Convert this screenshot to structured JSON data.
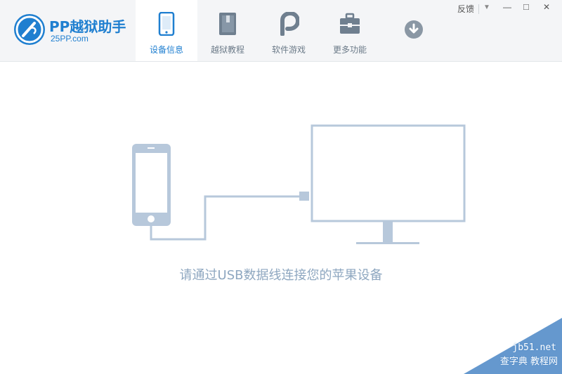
{
  "app": {
    "name": "PP越狱助手",
    "site": "25PP.com"
  },
  "tabs": [
    {
      "label": "设备信息",
      "icon": "phone-icon",
      "active": true
    },
    {
      "label": "越狱教程",
      "icon": "book-icon",
      "active": false
    },
    {
      "label": "软件游戏",
      "icon": "pp-app-icon",
      "active": false
    },
    {
      "label": "更多功能",
      "icon": "toolbox-icon",
      "active": false
    },
    {
      "label": "",
      "icon": "download-icon",
      "active": false
    }
  ],
  "window_controls": {
    "feedback": "反馈",
    "menu": "▼",
    "minimize": "—",
    "maximize": "□",
    "close": "✕"
  },
  "main": {
    "message": "请通过USB数据线连接您的苹果设备"
  },
  "watermark": {
    "line1": "jb51.net",
    "line2": "查字典 教程网"
  },
  "colors": {
    "brand": "#1f7fd0",
    "illustration": "#b7c8db",
    "message": "#8ea7c0"
  }
}
